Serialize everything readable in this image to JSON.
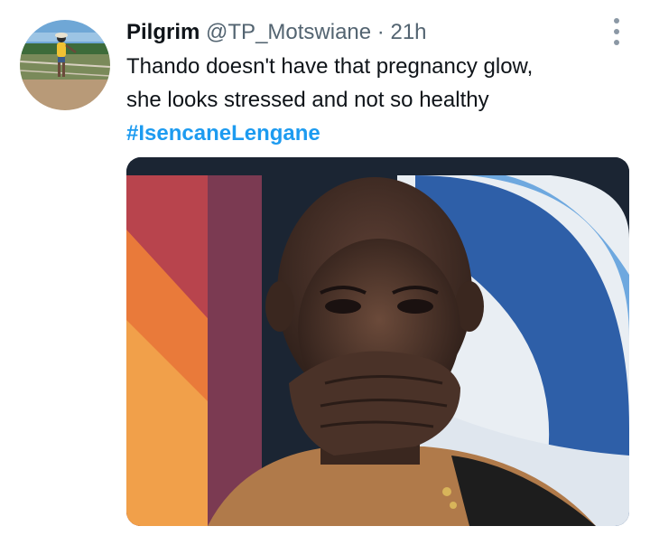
{
  "tweet": {
    "display_name": "Pilgrim",
    "handle": "@TP_Motswiane",
    "separator": "·",
    "time": "21h",
    "text_line1": "Thando doesn't have that pregnancy glow,",
    "text_line2": "she looks stressed and not so healthy",
    "hashtag": "#IsencaneLengane",
    "more_icon": "more-horizontal-icon",
    "media_alt": "photo"
  },
  "colors": {
    "text": "#0f1419",
    "secondary": "#536471",
    "link": "#1d9bf0",
    "background": "#ffffff"
  }
}
